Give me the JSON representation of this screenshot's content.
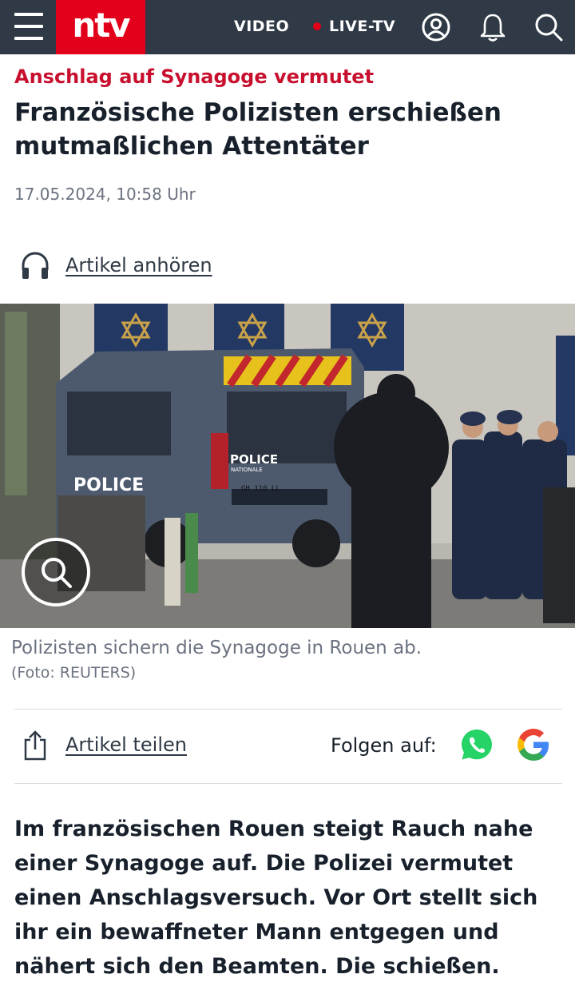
{
  "header": {
    "logo": "ntv",
    "video": "VIDEO",
    "live_tv": "LIVE-TV",
    "icons": [
      "menu-icon",
      "user-icon",
      "bell-icon",
      "search-icon"
    ],
    "brand_color": "#e2001a",
    "bar_color": "#2f3a46"
  },
  "article": {
    "kicker": "Anschlag auf Synagoge vermutet",
    "headline": "Französische Polizisten erschießen mutmaßlichen Attentäter",
    "date": "17.05.2024, 10:58 Uhr",
    "listen_label": "Artikel anhören",
    "image": {
      "caption": "Polizisten sichern die Synagoge in Rouen ab.",
      "credit": "(Foto: REUTERS)",
      "van_text": "POLICE",
      "van_subtext": "NATIONALE",
      "plate": "GH 110 LL"
    },
    "share_label": "Artikel teilen",
    "follow_label": "Folgen auf:",
    "lead": "Im französischen Rouen steigt Rauch nahe einer Synagoge auf. Die Polizei vermutet einen Anschlagsversuch. Vor Ort stellt sich ihr ein bewaffneter Mann entgegen und nähert sich den Beamten. Die schießen."
  }
}
